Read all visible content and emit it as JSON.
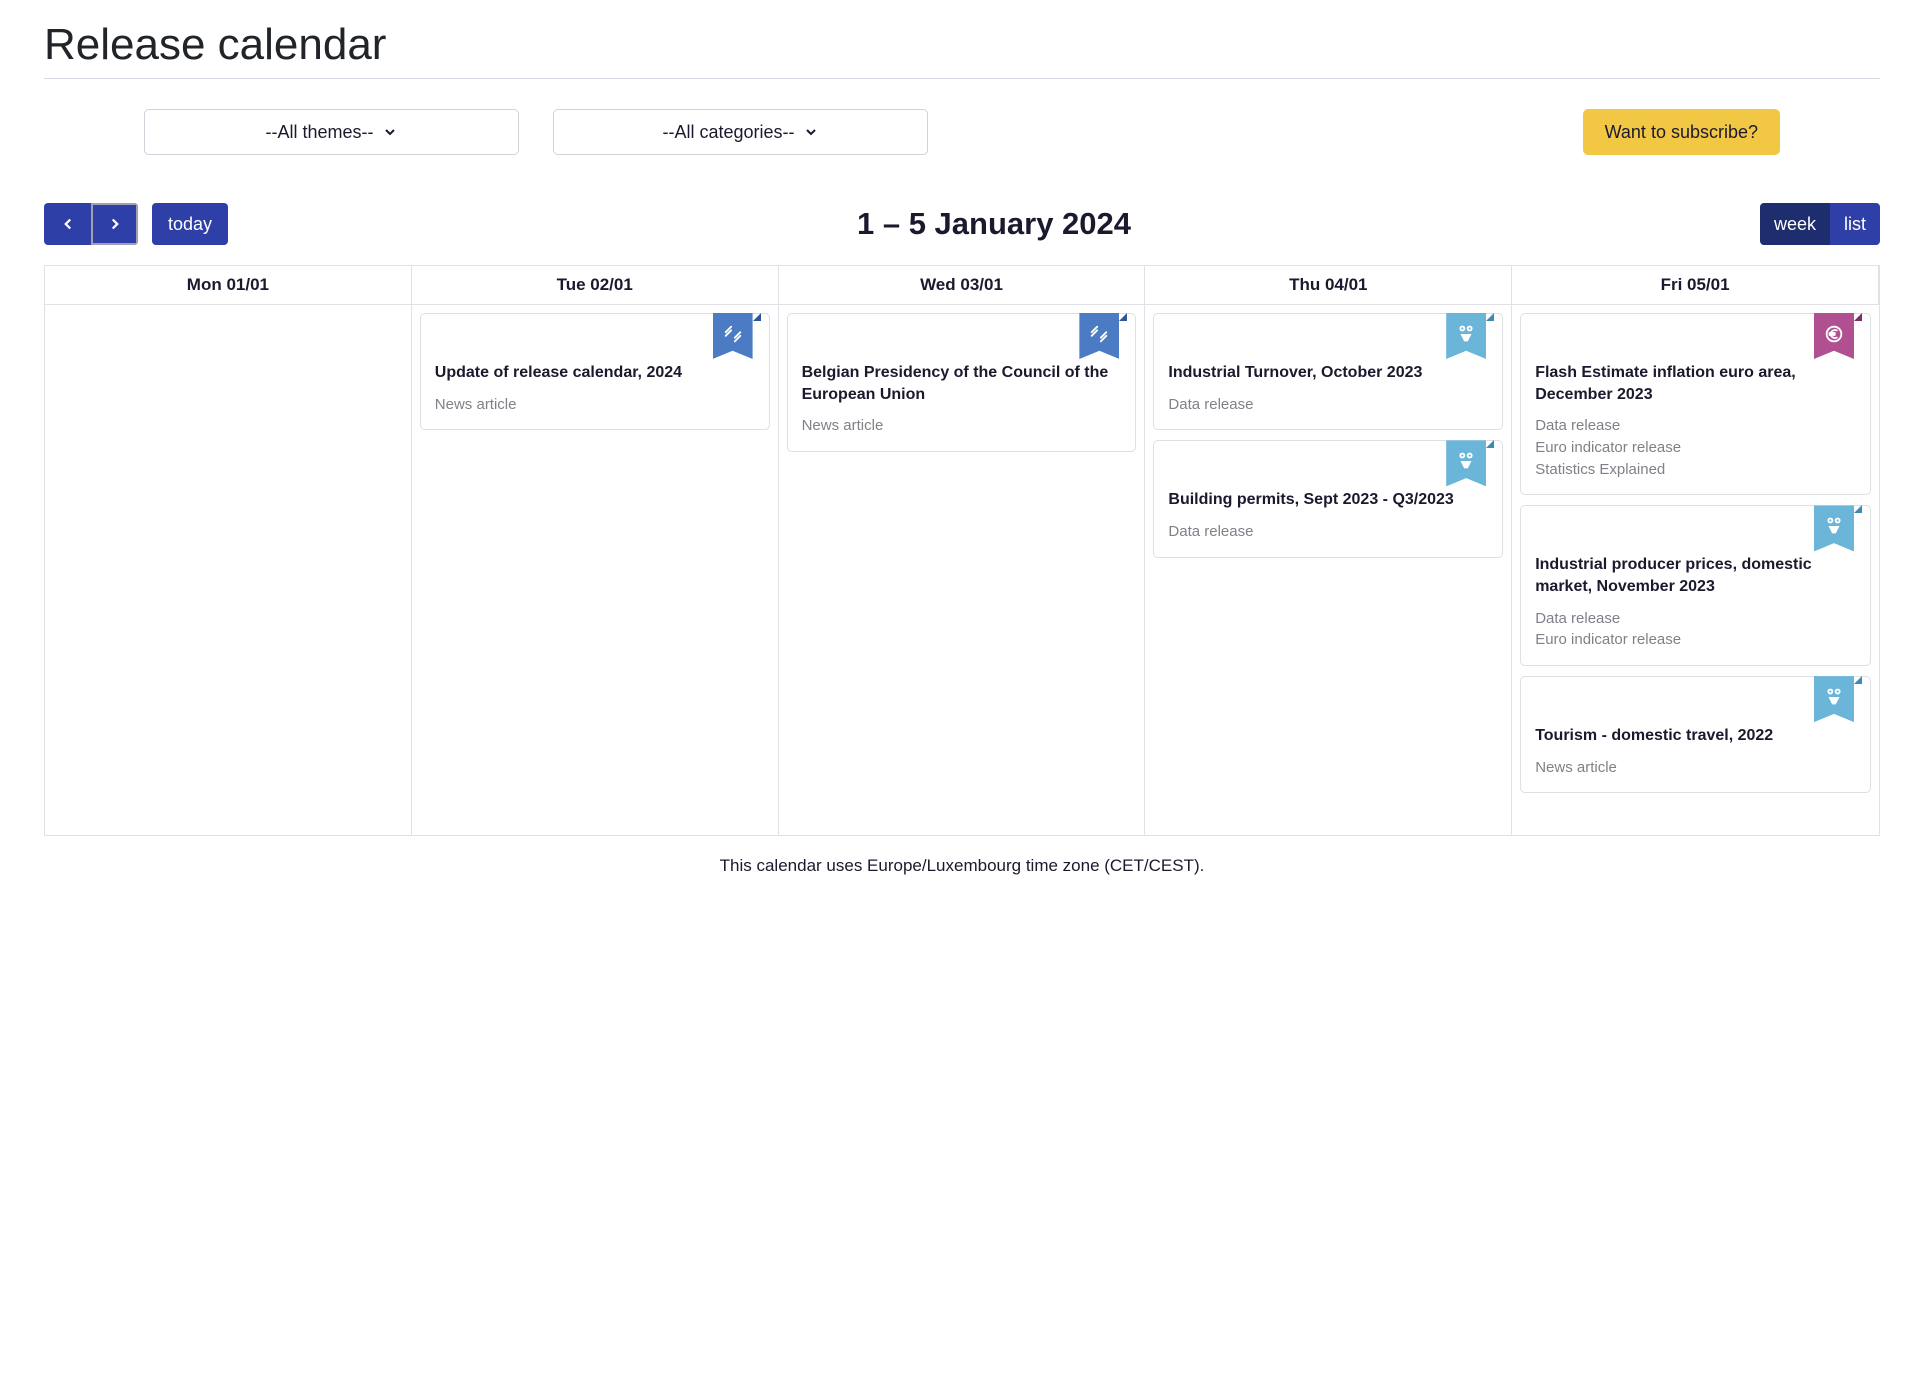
{
  "page_title": "Release calendar",
  "filters": {
    "themes_label": "--All themes--",
    "categories_label": "--All categories--"
  },
  "subscribe_label": "Want to subscribe?",
  "nav": {
    "today_label": "today",
    "date_range": "1 – 5 January 2024",
    "week_label": "week",
    "list_label": "list"
  },
  "days": [
    {
      "header": "Mon 01/01",
      "events": []
    },
    {
      "header": "Tue 02/01",
      "events": [
        {
          "title": "Update of release calendar, 2024",
          "tags": [
            "News article"
          ],
          "badge": "news"
        }
      ]
    },
    {
      "header": "Wed 03/01",
      "events": [
        {
          "title": "Belgian Presidency of the Council of the European Union",
          "tags": [
            "News article"
          ],
          "badge": "news"
        }
      ]
    },
    {
      "header": "Thu 04/01",
      "events": [
        {
          "title": "Industrial Turnover, October 2023",
          "tags": [
            "Data release"
          ],
          "badge": "data"
        },
        {
          "title": "Building permits, Sept 2023 - Q3/2023",
          "tags": [
            "Data release"
          ],
          "badge": "data"
        }
      ]
    },
    {
      "header": "Fri 05/01",
      "events": [
        {
          "title": "Flash Estimate inflation euro area, December 2023",
          "tags": [
            "Data release",
            "Euro indicator release",
            "Statistics Explained"
          ],
          "badge": "euro"
        },
        {
          "title": "Industrial producer prices, domestic market, November 2023",
          "tags": [
            "Data release",
            "Euro indicator release"
          ],
          "badge": "data"
        },
        {
          "title": "Tourism - domestic travel, 2022",
          "tags": [
            "News article"
          ],
          "badge": "data"
        }
      ]
    }
  ],
  "footnote": "This calendar uses Europe/Luxembourg time zone (CET/CEST).",
  "badge_colors": {
    "news": "badge-blue",
    "data": "badge-lightblue",
    "euro": "badge-purple"
  }
}
